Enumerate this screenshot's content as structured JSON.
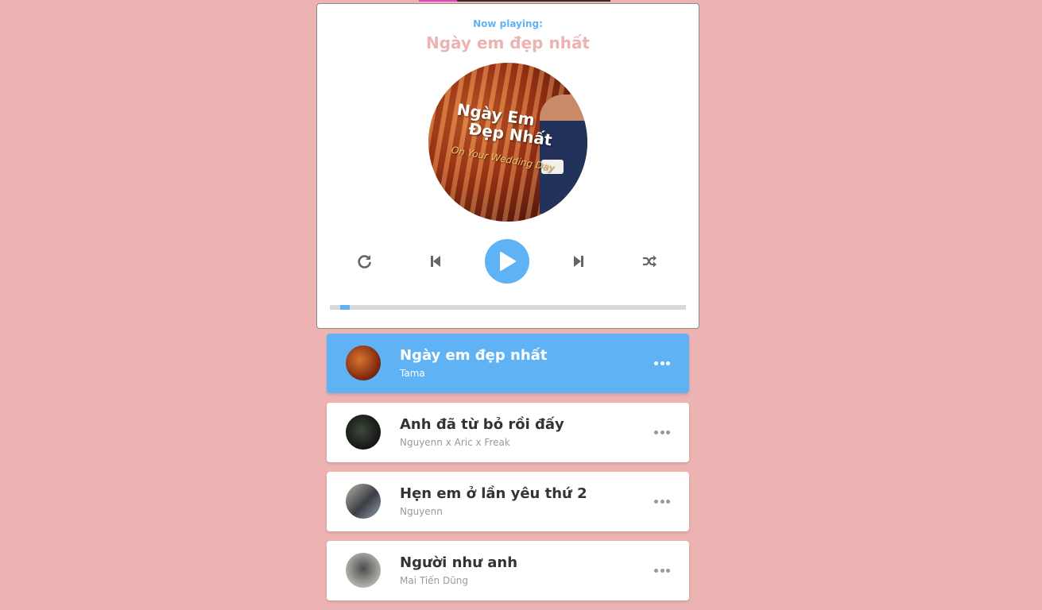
{
  "header": {
    "now_playing_label": "Now playing:",
    "current_song": "Ngày em đẹp nhất"
  },
  "cd": {
    "title_line1": "Ngày Em",
    "title_line2": "Đẹp Nhất",
    "subtitle": "On Your Wedding Day"
  },
  "controls": {
    "repeat_icon": "redo-icon",
    "prev_icon": "step-backward-icon",
    "play_icon": "play-icon",
    "next_icon": "step-forward-icon",
    "random_icon": "random-icon"
  },
  "progress": {
    "percent": 3
  },
  "playlist": [
    {
      "name": "Ngày em đẹp nhất",
      "author": "Tama",
      "active": true
    },
    {
      "name": "Anh đã từ bỏ rồi đấy",
      "author": "Nguyenn x Aric x Freak",
      "active": false
    },
    {
      "name": "Hẹn em ở lần yêu thứ 2",
      "author": "Nguyenn",
      "active": false
    },
    {
      "name": "Người như anh",
      "author": "Mai Tiến Dũng",
      "active": false
    }
  ],
  "colors": {
    "background": "#ecb3b2",
    "accent": "#5fb3f5",
    "title": "#ecb3b2"
  }
}
